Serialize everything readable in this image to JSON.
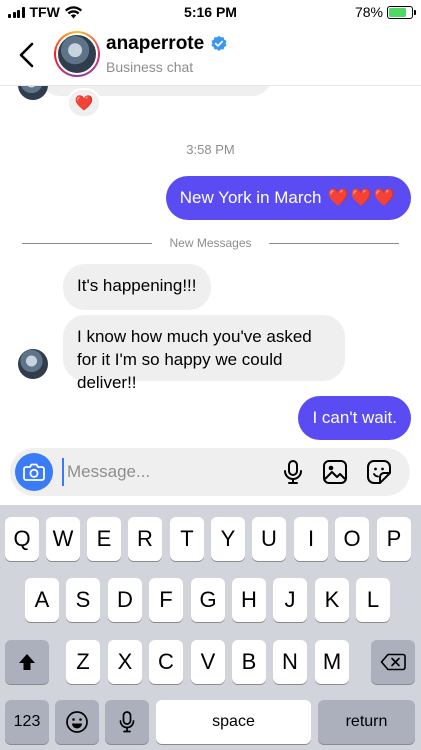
{
  "status_bar": {
    "carrier": "TFW",
    "time": "5:16 PM",
    "battery": "78%",
    "battery_level": 0.78
  },
  "header": {
    "name": "anaperrote",
    "subtitle": "Business chat",
    "back_icon": "chevron-left-icon",
    "verified_icon": "verified-badge-icon"
  },
  "conversation": {
    "reaction": "❤️",
    "timestamp": "3:58 PM",
    "sent_1": {
      "text": "New York in March",
      "hearts": "❤️❤️❤️"
    },
    "divider": "New Messages",
    "received": [
      "It's happening!!!",
      "I know how much you've asked for it I'm so happy we could deliver!!"
    ],
    "sent_2": "I can't wait."
  },
  "composer": {
    "placeholder": "Message...",
    "icons": [
      "camera-icon",
      "microphone-icon",
      "gallery-icon",
      "sticker-icon"
    ]
  },
  "keyboard": {
    "row1": [
      "Q",
      "W",
      "E",
      "R",
      "T",
      "Y",
      "U",
      "I",
      "O",
      "P"
    ],
    "row2": [
      "A",
      "S",
      "D",
      "F",
      "G",
      "H",
      "J",
      "K",
      "L"
    ],
    "row3": [
      "Z",
      "X",
      "C",
      "V",
      "B",
      "N",
      "M"
    ],
    "numbers": "123",
    "space": "space",
    "return": "return"
  },
  "colors": {
    "sent_bubble": "#5a4cf2",
    "received_bubble": "#efefef",
    "accent": "#3a7bf6",
    "keyboard_bg": "#d1d4da"
  }
}
